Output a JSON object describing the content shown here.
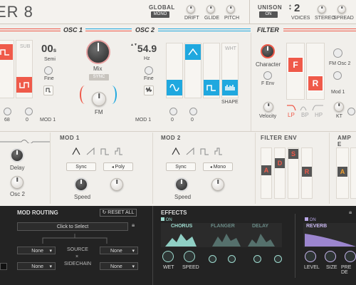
{
  "colors": {
    "accent_red": "#ef5a4a",
    "accent_blue": "#1fa8df",
    "teal": "#5fc3b5",
    "purple": "#a78bd6"
  },
  "header": {
    "logo": "ER 8",
    "global": {
      "title": "GLOBAL",
      "mode": "MONO",
      "knobs": [
        "DRIFT",
        "GLIDE",
        "PITCH"
      ]
    },
    "unison": {
      "title": "UNISON",
      "state": "ON",
      "voices": "2",
      "voices_label": "VOICES",
      "knobs": [
        "STEREO",
        "SPREAD"
      ]
    }
  },
  "osc1": {
    "title": "OSC 1",
    "semi": "00",
    "semi_unit": "s",
    "semi_label": "Semi",
    "fine_label": "Fine",
    "sub_label": "SUB",
    "values": [
      "68",
      "0"
    ],
    "mod": "MOD 1"
  },
  "osc2": {
    "title": "OSC 2",
    "hz": "54.9",
    "hz_unit": "Hz",
    "fine_label": "Fine",
    "wht_label": "WHT",
    "shape_label": "SHAPE",
    "values": [
      "0",
      "0"
    ],
    "mod": "MOD 1"
  },
  "mix": {
    "label": "Mix",
    "sync": "SYNC",
    "fm": "FM"
  },
  "filter": {
    "title": "FILTER",
    "character": "Character",
    "fenv": "F Env",
    "velocity": "Velocity",
    "fm_osc2": "FM Osc 2",
    "mod1": "Mod 1",
    "kt": "KT",
    "tile_f": "F",
    "tile_r": "R",
    "types": [
      "LP",
      "BP",
      "HP"
    ],
    "values": [
      "0"
    ]
  },
  "lfo": {
    "delay": "Delay",
    "osc2": "Osc 2"
  },
  "mod1": {
    "title": "MOD 1",
    "sync": "Sync",
    "mode": "Poly",
    "speed": "Speed"
  },
  "mod2": {
    "title": "MOD 2",
    "sync": "Sync",
    "mode": "Mono",
    "speed": "Speed"
  },
  "filter_env": {
    "title": "FILTER ENV",
    "a": "A",
    "d": "D",
    "s": "S",
    "r": "R"
  },
  "amp_env": {
    "title": "AMP E",
    "a": "A"
  },
  "mod_routing": {
    "title": "MOD ROUTING",
    "reset": "RESET ALL",
    "select": "Click to Select",
    "source": "SOURCE",
    "x": "×",
    "sidechain": "SIDECHAIN",
    "none": "None"
  },
  "effects": {
    "title": "EFFECTS",
    "on": "ON",
    "chorus": "CHORUS",
    "flanger": "FLANGER",
    "delay": "DELAY",
    "wet": "WET",
    "speed": "SPEED",
    "reverb": "REVERB",
    "level": "LEVEL",
    "size": "SIZE",
    "predelay": "PRE DE"
  }
}
